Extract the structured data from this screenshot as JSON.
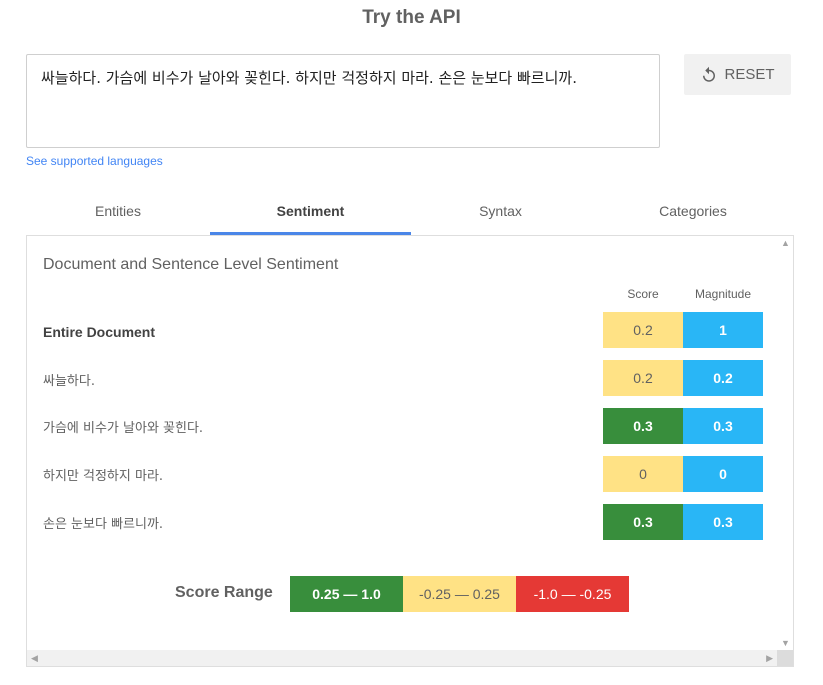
{
  "header": {
    "title": "Try the API"
  },
  "input": {
    "text": "싸늘하다. 가슴에 비수가 날아와 꽂힌다. 하지만 걱정하지 마라. 손은 눈보다 빠르니까."
  },
  "reset_button": {
    "label": "RESET",
    "icon": "reset-icon"
  },
  "languages_link": "See supported languages",
  "tabs": [
    {
      "label": "Entities"
    },
    {
      "label": "Sentiment",
      "active": true
    },
    {
      "label": "Syntax"
    },
    {
      "label": "Categories"
    }
  ],
  "panel": {
    "title": "Document and Sentence Level Sentiment",
    "columns": {
      "score": "Score",
      "magnitude": "Magnitude"
    },
    "rows": [
      {
        "label": "Entire Document",
        "score": "0.2",
        "magnitude": "1"
      },
      {
        "label": "싸늘하다.",
        "score": "0.2",
        "magnitude": "0.2"
      },
      {
        "label": "가슴에 비수가 날아와 꽂힌다.",
        "score": "0.3",
        "magnitude": "0.3"
      },
      {
        "label": "하지만 걱정하지 마라.",
        "score": "0",
        "magnitude": "0"
      },
      {
        "label": "손은 눈보다 빠르니까.",
        "score": "0.3",
        "magnitude": "0.3"
      }
    ],
    "score_range": {
      "label": "Score Range",
      "ranges": [
        {
          "label": "0.25 — 1.0"
        },
        {
          "label": "-0.25 — 0.25"
        },
        {
          "label": "-1.0 — -0.25"
        }
      ]
    }
  },
  "colors": {
    "positive": "#388e3c",
    "neutral": "#ffe285",
    "negative": "#e53935",
    "magnitude": "#29b6f6",
    "tab_indicator": "#4a86e8",
    "link": "#4285f4"
  }
}
